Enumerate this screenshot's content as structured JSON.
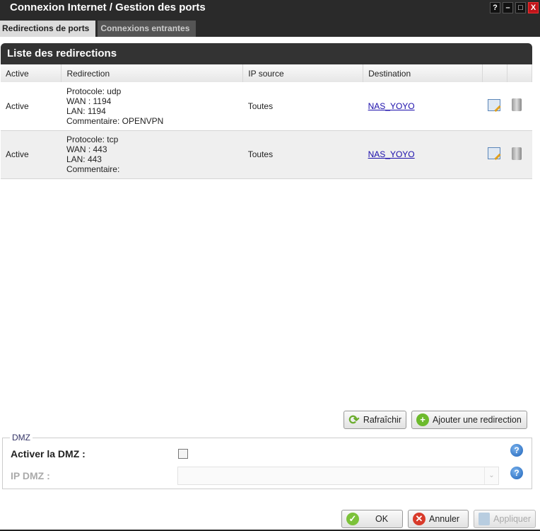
{
  "window": {
    "title": "Connexion Internet / Gestion des ports",
    "help": "?",
    "minimize": "–",
    "maximize": "□",
    "close": "X"
  },
  "tabs": [
    {
      "label": "Redirections de ports"
    },
    {
      "label": "Connexions entrantes"
    }
  ],
  "panel": {
    "title": "Liste des redirections",
    "columns": [
      "Active",
      "Redirection",
      "IP source",
      "Destination"
    ],
    "rows": [
      {
        "active": "Active",
        "protocol": "Protocole: udp",
        "wan": "WAN : 1194",
        "lan": "LAN: 1194",
        "comment": "Commentaire: OPENVPN",
        "ip_source": "Toutes",
        "destination": "NAS_YOYO"
      },
      {
        "active": "Active",
        "protocol": "Protocole: tcp",
        "wan": "WAN : 443",
        "lan": "LAN: 443",
        "comment": "Commentaire:",
        "ip_source": "Toutes",
        "destination": "NAS_YOYO"
      }
    ]
  },
  "actions": {
    "refresh": "Rafraîchir",
    "add": "Ajouter une redirection"
  },
  "dmz": {
    "legend": "DMZ",
    "enable_label": "Activer la DMZ :",
    "enabled": false,
    "ip_label": "IP DMZ :",
    "ip_value": ""
  },
  "footer": {
    "ok": "OK",
    "cancel": "Annuler",
    "apply": "Appliquer"
  }
}
